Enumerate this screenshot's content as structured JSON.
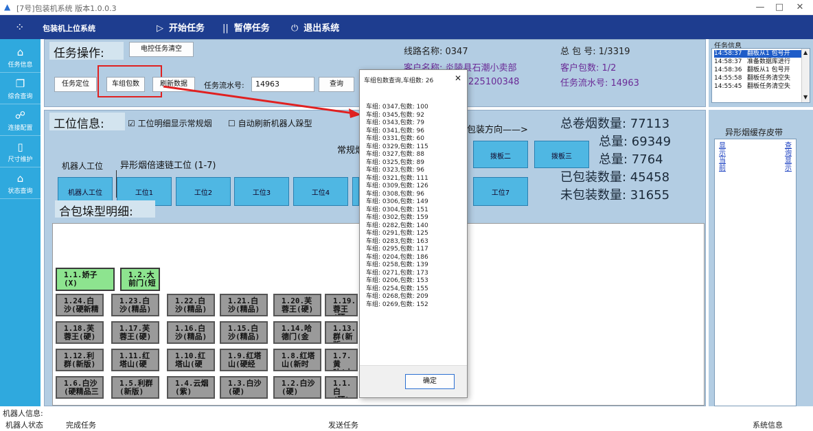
{
  "window": {
    "title": "[7号]包装机系统 版本1.0.0.3",
    "minimize": "—",
    "maximize": "□",
    "close": "✕"
  },
  "toolbar": {
    "app_name": "包装机上位系统",
    "start": "开始任务",
    "pause": "暂停任务",
    "exit": "退出系统"
  },
  "sidebar": {
    "items": [
      {
        "label": "任务信息",
        "icon": "home-icon"
      },
      {
        "label": "综合查询",
        "icon": "copy-icon"
      },
      {
        "label": "连接配置",
        "icon": "link-icon"
      },
      {
        "label": "尺寸维护",
        "icon": "doc-icon"
      },
      {
        "label": "状态查询",
        "icon": "home-icon"
      }
    ]
  },
  "task_ops": {
    "title": "任务操作:",
    "clear_btn": "电控任务清空",
    "locate_btn": "任务定位",
    "group_btn": "车组包数",
    "refresh_btn": "刷新数据",
    "serial_label": "任务流水号:",
    "serial_value": "14963",
    "query_btn": "查询"
  },
  "task_info_center": {
    "route": "线路名称: 0347",
    "customer": "客户名称: 炎陵县石潮小卖部",
    "customer_id": "225100348",
    "total": "总 包 号: 1/3319",
    "customer_packs": "客户包数: 1/2",
    "serial": "任务流水号: 14963"
  },
  "log": {
    "title": "任务信息",
    "rows": [
      {
        "time": "14:58:37",
        "msg": "翻板从1 包号开",
        "selected": true
      },
      {
        "time": "14:58:37",
        "msg": "准备数据库进行"
      },
      {
        "time": "14:58:36",
        "msg": "翻板从1 包号开"
      },
      {
        "time": "14:55:58",
        "msg": "翻板任务清空失"
      },
      {
        "time": "14:55:45",
        "msg": "翻板任务清空失"
      }
    ]
  },
  "station_info": {
    "title": "工位信息:",
    "chk_show": "工位明细显示常规烟",
    "chk_auto": "自动刷新机器人跺型",
    "direction": "包装方向——>",
    "robot_label": "机器人工位",
    "special_label": "异形烟倍速链工位 (1-7)",
    "regular_label": "常规烟",
    "flip2": "拨板二",
    "flip3": "拨板三",
    "stations": [
      "机器人工位",
      "工位1",
      "工位2",
      "工位3",
      "工位4",
      "工位7"
    ],
    "stats": {
      "total_rolls": "总卷烟数量: 77113",
      "line2": "总量: 69349",
      "line3": "总量: 7764",
      "packed": "已包装数量: 45458",
      "unpacked": "未包装数量: 31655"
    }
  },
  "special_belt": {
    "title": "异形烟缓存皮带",
    "col1": "显示当前",
    "col2": "查询显示"
  },
  "stack_detail": {
    "title": "合包垛型明细:",
    "green_cells": [
      [
        "1.1.娇子",
        "(X)"
      ],
      [
        "1.2.大",
        "前门(短"
      ]
    ],
    "rows": [
      [
        [
          "1.24.白",
          "沙(硬新精"
        ],
        [
          "1.23.白",
          "沙(精品)"
        ],
        [
          "1.22.白",
          "沙(精品)"
        ],
        [
          "1.21.白",
          "沙(精品)"
        ],
        [
          "1.20.芙",
          "蓉王(硬)"
        ],
        [
          "1.19.",
          "蓉王(硬"
        ]
      ],
      [
        [
          "1.18.芙",
          "蓉王(硬)"
        ],
        [
          "1.17.芙",
          "蓉王(硬)"
        ],
        [
          "1.16.白",
          "沙(精品)"
        ],
        [
          "1.15.白",
          "沙(精品)"
        ],
        [
          "1.14.哈",
          "德门(金"
        ],
        [
          "1.13.",
          "群(新版"
        ]
      ],
      [
        [
          "1.12.利",
          "群(新版)"
        ],
        [
          "1.11.红",
          "塔山(硬"
        ],
        [
          "1.10.红",
          "塔山(硬"
        ],
        [
          "1.9.红塔",
          "山(硬经"
        ],
        [
          "1.8.红塔",
          "山(新时"
        ],
        [
          "1.7.黄",
          "叶(小"
        ]
      ],
      [
        [
          "1.6.白沙",
          "(硬精品三"
        ],
        [
          "1.5.利群",
          "(新版)"
        ],
        [
          "1.4.云烟",
          "(紫)"
        ],
        [
          "1.3.白沙",
          "(硬)"
        ],
        [
          "1.2.白沙",
          "(硬)"
        ],
        [
          "1.1.白",
          "(硬)"
        ]
      ]
    ]
  },
  "dialog": {
    "title": "车组包数查询,车组数: 26",
    "close": "✕",
    "ok": "确定",
    "rows": [
      "车组: 0347,包数: 100",
      "车组: 0345,包数: 92",
      "车组: 0343,包数: 79",
      "车组: 0341,包数: 96",
      "车组: 0331,包数: 60",
      "车组: 0329,包数: 115",
      "车组: 0327,包数: 88",
      "车组: 0325,包数: 89",
      "车组: 0323,包数: 96",
      "车组: 0321,包数: 111",
      "车组: 0309,包数: 126",
      "车组: 0308,包数: 96",
      "车组: 0306,包数: 149",
      "车组: 0304,包数: 151",
      "车组: 0302,包数: 159",
      "车组: 0282,包数: 140",
      "车组: 0291,包数: 125",
      "车组: 0283,包数: 163",
      "车组: 0295,包数: 117",
      "车组: 0204,包数: 186",
      "车组: 0258,包数: 139",
      "车组: 0271,包数: 173",
      "车组: 0206,包数: 153",
      "车组: 0254,包数: 155",
      "车组: 0268,包数: 209",
      "车组: 0269,包数: 152"
    ]
  },
  "bottom": {
    "robot_info": "机器人信息:",
    "robot_status": "机器人状态",
    "done": "完成任务",
    "send": "发送任务",
    "sysinfo": "系统信息"
  },
  "colors": {
    "toolbar": "#1e3d8f",
    "sidebar": "#2fa9de",
    "panel": "#b3cde3",
    "highlight": "#e02020"
  }
}
